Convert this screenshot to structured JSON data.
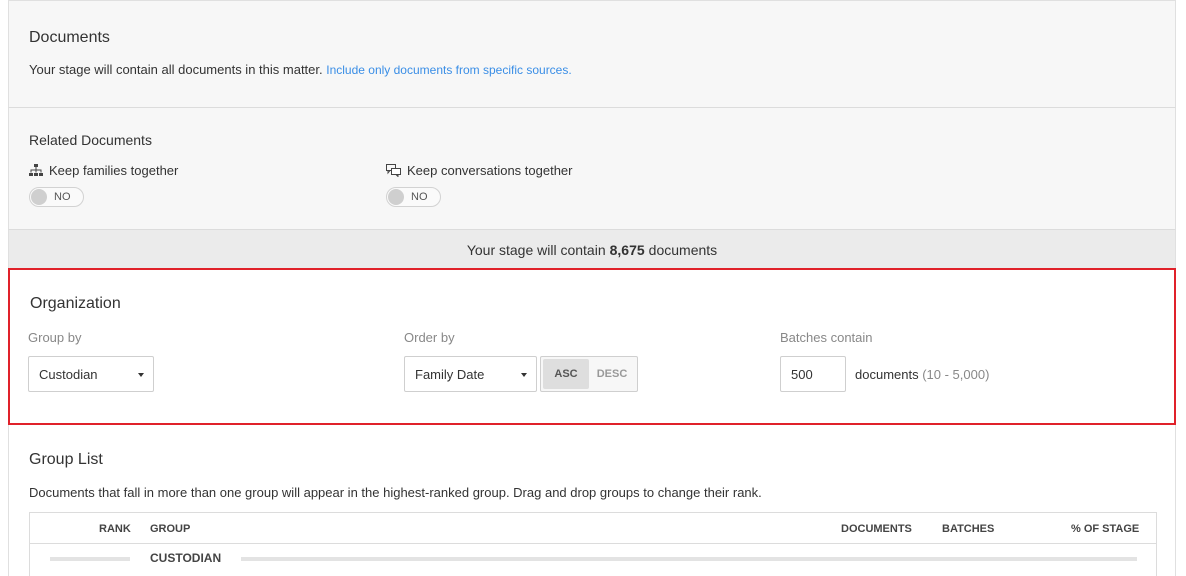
{
  "documents": {
    "title": "Documents",
    "text": "Your stage will contain all documents in this matter.",
    "link": "Include only documents from specific sources."
  },
  "related": {
    "title": "Related Documents",
    "families_label": "Keep families together",
    "families_value": "NO",
    "conversations_label": "Keep conversations together",
    "conversations_value": "NO"
  },
  "summary": {
    "prefix": "Your stage will contain",
    "count": "8,675",
    "suffix": "documents"
  },
  "organization": {
    "title": "Organization",
    "group_by_label": "Group by",
    "group_by_value": "Custodian",
    "order_by_label": "Order by",
    "order_by_value": "Family Date",
    "asc_label": "ASC",
    "desc_label": "DESC",
    "active_order": "ASC",
    "batches_label": "Batches contain",
    "batches_value": "500",
    "batches_suffix": "documents",
    "batches_range": "(10 - 5,000)"
  },
  "group_list": {
    "title": "Group List",
    "description": "Documents that fall in more than one group will appear in the highest-ranked group. Drag and drop groups to change their rank.",
    "columns": {
      "rank": "RANK",
      "group": "GROUP",
      "documents": "DOCUMENTS",
      "batches": "BATCHES",
      "pct": "% OF STAGE"
    },
    "rows": [
      {
        "group": "CUSTODIAN"
      }
    ]
  },
  "colors": {
    "accent_link": "#3a8ee6",
    "highlight_border": "#e0212a"
  }
}
